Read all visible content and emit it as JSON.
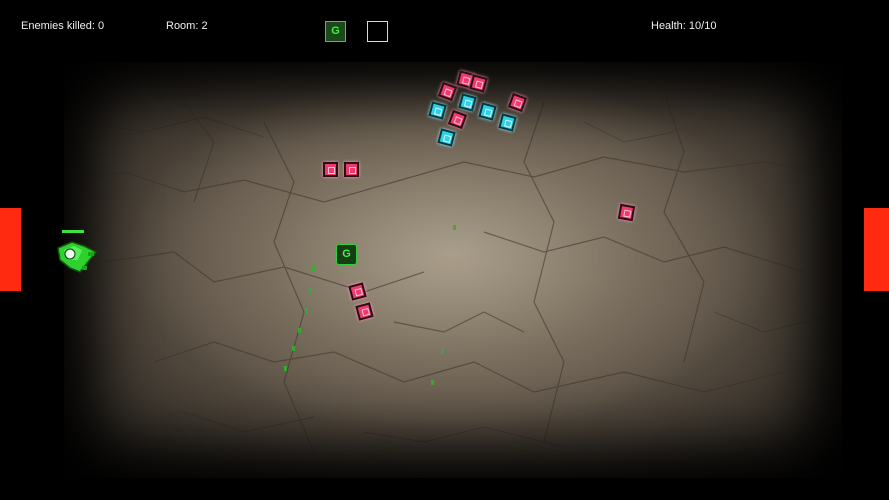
{
  "hud": {
    "enemies_killed": "Enemies killed: 0",
    "room": "Room: 2",
    "health": "Health: 10/10",
    "inventory": [
      {
        "name": "g-weapon-slot",
        "label": "G",
        "filled": true
      },
      {
        "name": "empty-slot",
        "label": "",
        "filled": false
      }
    ]
  },
  "pickup": {
    "label": "G"
  },
  "colors": {
    "door": "#ff2a0f",
    "player": "#3fe13f",
    "enemy_pink": "#ef3a6f",
    "enemy_cyan": "#2dd0e6"
  },
  "player": {
    "health_fraction": 1.0
  }
}
